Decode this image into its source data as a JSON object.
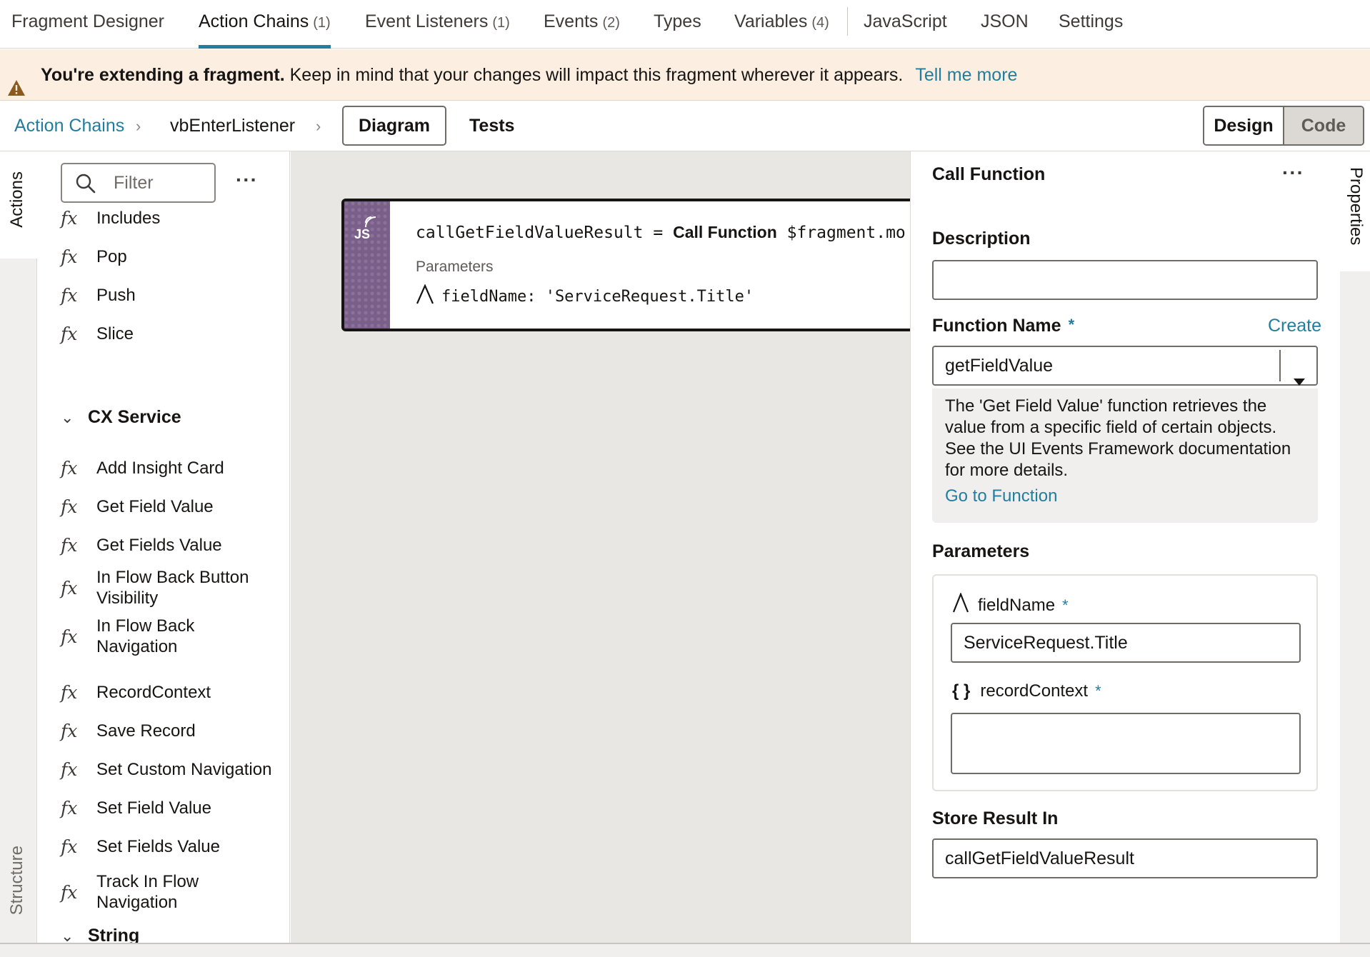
{
  "tabs": [
    {
      "label": "Fragment Designer",
      "count": ""
    },
    {
      "label": "Action Chains",
      "count": "(1)"
    },
    {
      "label": "Event Listeners",
      "count": "(1)"
    },
    {
      "label": "Events",
      "count": "(2)"
    },
    {
      "label": "Types",
      "count": ""
    },
    {
      "label": "Variables",
      "count": "(4)"
    },
    {
      "label": "JavaScript",
      "count": ""
    },
    {
      "label": "JSON",
      "count": ""
    },
    {
      "label": "Settings",
      "count": ""
    }
  ],
  "banner": {
    "bold": "You're extending a fragment.",
    "text": "Keep in mind that your changes will impact this fragment wherever it appears.",
    "link": "Tell me more"
  },
  "breadcrumb": {
    "root": "Action Chains",
    "current": "vbEnterListener",
    "diagram": "Diagram",
    "tests": "Tests",
    "design": "Design",
    "code": "Code"
  },
  "rails": {
    "actions": "Actions",
    "structure": "Structure",
    "properties": "Properties"
  },
  "actions_panel": {
    "filter_placeholder": "Filter",
    "more": "···",
    "top_items": [
      "Includes",
      "Pop",
      "Push",
      "Slice"
    ],
    "group1": "CX Service",
    "group1_items": [
      "Add Insight Card",
      "Get Field Value",
      "Get Fields Value",
      "In Flow Back Button Visibility",
      "In Flow Back Navigation",
      "RecordContext",
      "Save Record",
      "Set Custom Navigation",
      "Set Field Value",
      "Set Fields Value",
      "Track In Flow Navigation"
    ],
    "group2": "String",
    "fx": "fx"
  },
  "card": {
    "badge": "JS",
    "result_var": "callGetFieldValueResult",
    "eq": "=",
    "action": "Call Function",
    "target": "$fragment.mo",
    "params_label": "Parameters",
    "param_text": "fieldName: 'ServiceRequest.Title'"
  },
  "properties": {
    "title": "Call Function",
    "more": "···",
    "description_label": "Description",
    "description_value": "",
    "function_name_label": "Function Name",
    "required": "*",
    "create_link": "Create",
    "function_name_value": "getFieldValue",
    "help_text": "The 'Get Field Value' function retrieves the value from a specific field of certain objects. See the UI Events Framework documentation for more details.",
    "go_to_function": "Go to Function",
    "parameters_label": "Parameters",
    "param1_icon": "A",
    "param1_name": "fieldName",
    "param1_value": "ServiceRequest.Title",
    "param2_icon": "{ }",
    "param2_name": "recordContext",
    "param2_value": "",
    "store_result_label": "Store Result In",
    "store_result_value": "callGetFieldValueResult"
  },
  "colors": {
    "accent": "#227e9e",
    "banner_bg": "#fcefe2",
    "warn_icon": "#8a5a1f",
    "js_strip": "#7a5f8a"
  }
}
